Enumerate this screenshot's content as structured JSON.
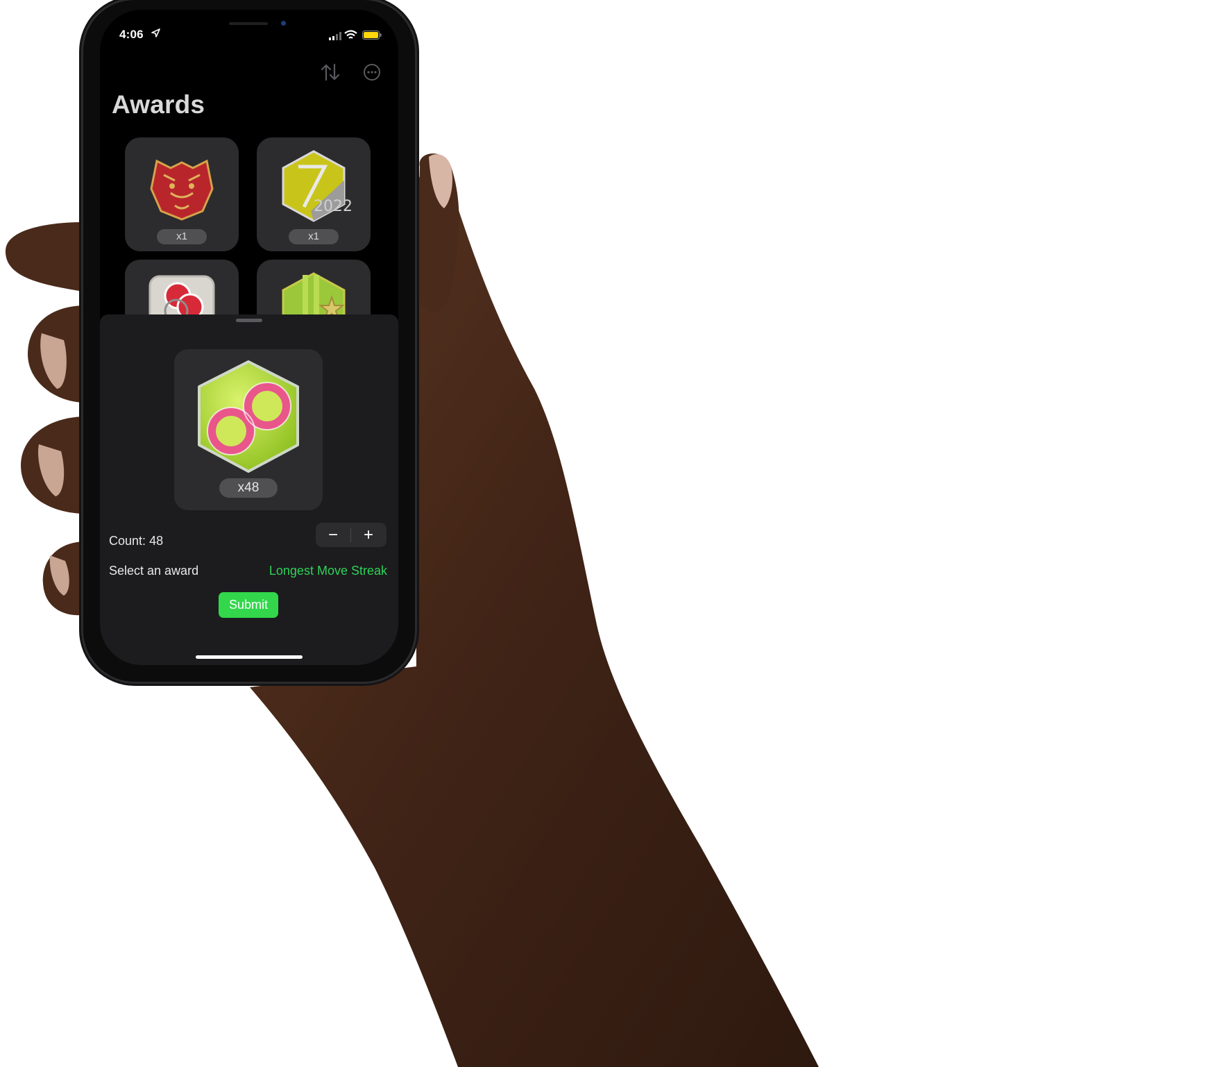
{
  "status_bar": {
    "time": "4:06"
  },
  "header": {
    "title": "Awards"
  },
  "awards": [
    {
      "icon": "tiger-award-icon",
      "count": "x1"
    },
    {
      "icon": "year-2022-award-icon",
      "count": "x1"
    },
    {
      "icon": "rings-award-icon",
      "count": ""
    },
    {
      "icon": "star-award-icon",
      "count": ""
    }
  ],
  "sheet": {
    "preview_icon": "infinity-move-streak-award-icon",
    "preview_count": "x48",
    "count_label": "Count:",
    "count_value": "48",
    "stepper_minus": "−",
    "stepper_plus": "+",
    "select_label": "Select an award",
    "selected_award": "Longest Move Streak",
    "submit_label": "Submit"
  },
  "colors": {
    "accent_green": "#30d158",
    "submit_green": "#32d74b",
    "sheet_bg": "#1c1c1e",
    "card_bg": "#2c2c2e"
  }
}
